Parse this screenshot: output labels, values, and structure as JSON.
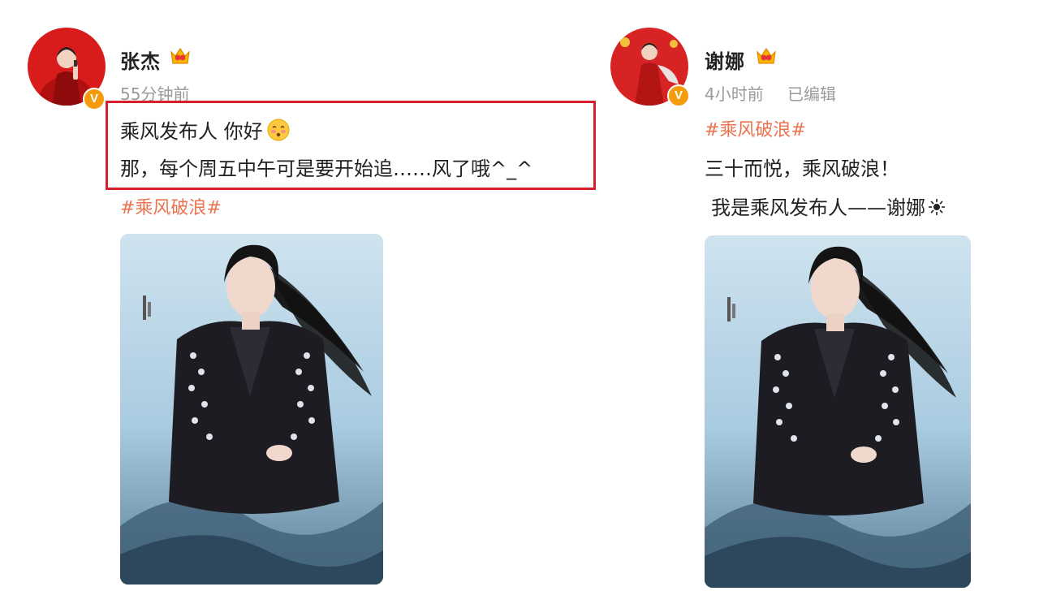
{
  "posts": [
    {
      "username": "张杰",
      "timestamp": "55分钟前",
      "line1": "乘风发布人 你好",
      "line2": "那，每个周五中午可是要开始追……风了哦^_^",
      "hashtag": "#乘风破浪#",
      "badge": "V"
    },
    {
      "username": "谢娜",
      "timestamp": "4小时前",
      "edited": "已编辑",
      "hashtag": "#乘风破浪#",
      "line1": "三十而悦，乘风破浪！",
      "line2": "我是乘风发布人——谢娜",
      "badge": "V"
    }
  ],
  "colors": {
    "hashtag": "#eb7350",
    "highlight": "#d9202a",
    "verified": "#f59a0b"
  }
}
